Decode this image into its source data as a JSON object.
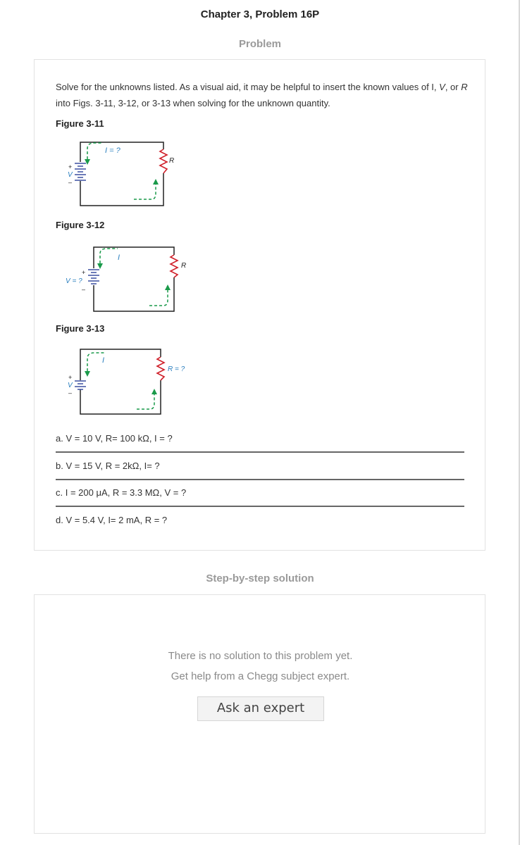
{
  "header": {
    "title": "Chapter 3, Problem 16P"
  },
  "problem": {
    "heading": "Problem",
    "intro_prefix": "Solve for the unknowns listed. As a visual aid, it may be helpful to insert the known values of I, ",
    "intro_v": "V",
    "intro_or": ", or ",
    "intro_r": "R",
    "intro_suffix": " into Figs. 3-11, 3-12, or 3-13 when solving for the unknown quantity.",
    "figures": [
      {
        "label": "Figure 3-11",
        "current": "I = ?",
        "voltage": "V",
        "resistor": "R"
      },
      {
        "label": "Figure 3-12",
        "current": "I",
        "voltage": "V = ?",
        "resistor": "R"
      },
      {
        "label": "Figure 3-13",
        "current": "I",
        "voltage": "V",
        "resistor": "R = ?"
      }
    ],
    "plus": "+",
    "minus": "–",
    "parts": [
      "a. V = 10 V, R= 100 kΩ, I = ?",
      "b. V = 15 V, R = 2kΩ, I= ?",
      "c. I = 200 μA, R = 3.3 MΩ, V = ?",
      "d. V = 5.4 V, I= 2 mA, R = ?"
    ]
  },
  "solution": {
    "heading": "Step-by-step solution",
    "message_line1": "There is no solution to this problem yet.",
    "message_line2": "Get help from a Chegg subject expert.",
    "button_label": "Ask an expert"
  },
  "colors": {
    "battery_blue": "#3a4fa0",
    "resistor_red": "#d0202a",
    "arrow_green": "#1a9a4a",
    "label_blue": "#2a7fbf"
  }
}
